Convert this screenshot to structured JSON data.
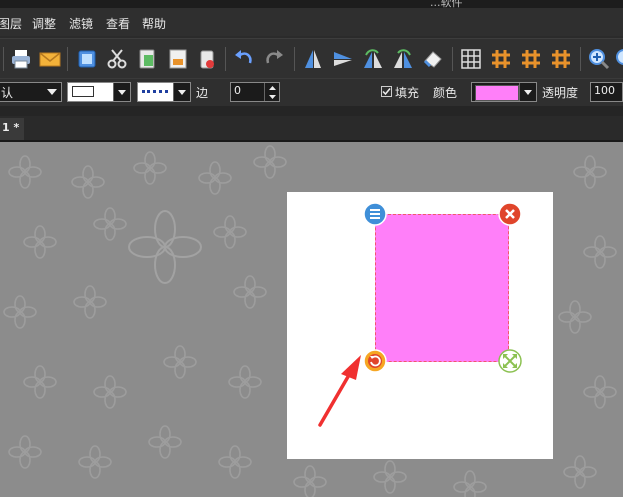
{
  "window": {
    "title": "...软件"
  },
  "menu": [
    "图层",
    "调整",
    "滤镜",
    "查看",
    "帮助"
  ],
  "toolbar": {
    "buttons": [
      "print",
      "email",
      "copy",
      "cut",
      "paste",
      "save",
      "delete",
      "undo",
      "redo",
      "flip-vertical",
      "flip-horizontal",
      "rotate-left",
      "rotate-right",
      "erase",
      "grid",
      "hash-1",
      "hash-2",
      "hash-3",
      "zoom-in",
      "zoom-out"
    ]
  },
  "properties": {
    "preset_value": "认",
    "edge_label": "边",
    "edge_value": "0",
    "fill_checked": true,
    "fill_label": "填充",
    "color_label": "颜色",
    "color_value": "#ff7ff9",
    "opacity_label": "透明度",
    "opacity_value": "100"
  },
  "tabs": [
    {
      "label": "1 *"
    }
  ],
  "canvas": {
    "shape_color": "#ff7ff9",
    "shape_border_color": "#f05a6a",
    "handles": [
      "menu-icon",
      "close-icon",
      "rotate-icon",
      "resize-icon"
    ]
  }
}
